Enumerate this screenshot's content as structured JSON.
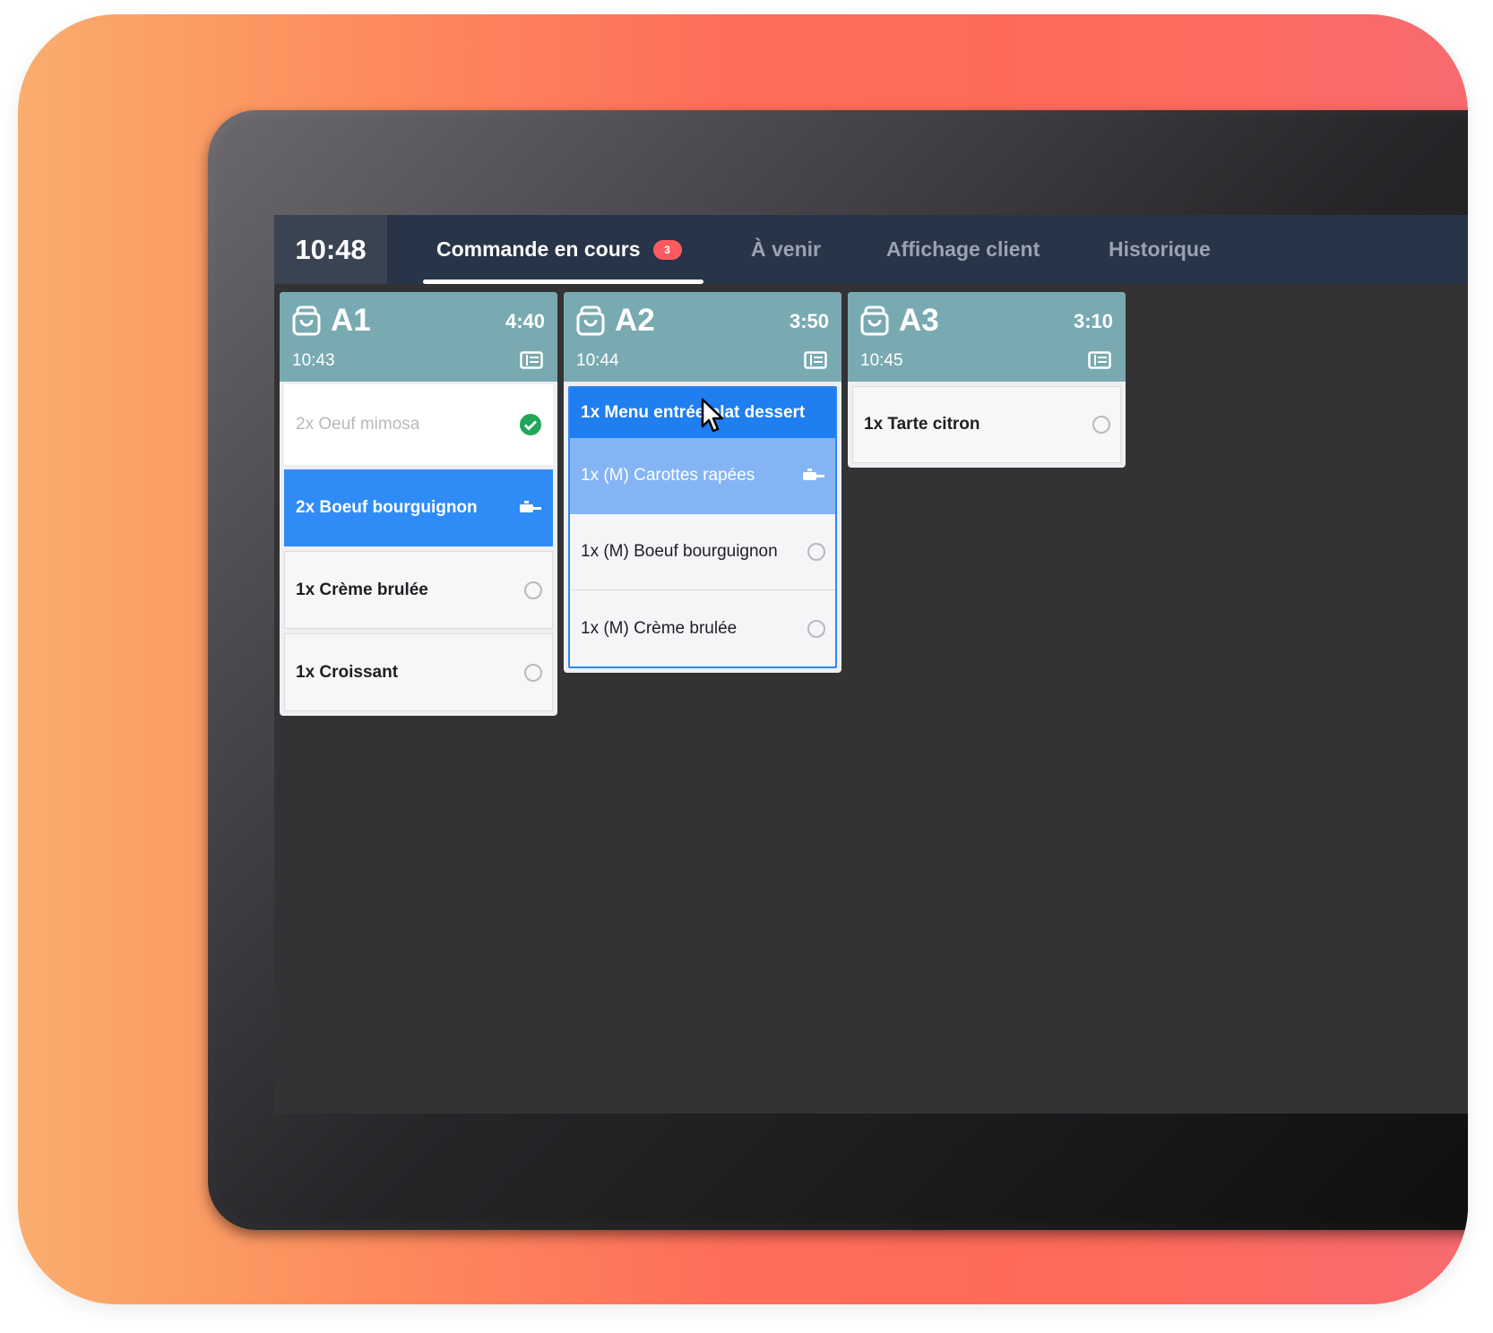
{
  "header": {
    "clock": "10:48",
    "tabs": [
      {
        "label": "Commande en cours",
        "badge": "3"
      },
      {
        "label": "À venir"
      },
      {
        "label": "Affichage client"
      },
      {
        "label": "Historique"
      }
    ]
  },
  "orders": [
    {
      "name": "A1",
      "timer": "4:40",
      "time": "10:43",
      "items": [
        {
          "label": "2x Oeuf mimosa",
          "status": "done"
        },
        {
          "label": "2x Boeuf bourguignon",
          "status": "in-progress"
        },
        {
          "label": "1x Crème brulée",
          "status": "pending"
        },
        {
          "label": "1x Croissant",
          "status": "pending"
        }
      ]
    },
    {
      "name": "A2",
      "timer": "3:50",
      "time": "10:44",
      "menu": {
        "label": "1x Menu entrée plat dessert",
        "items": [
          {
            "label": "1x (M) Carottes rapées",
            "status": "in-progress"
          },
          {
            "label": "1x (M) Boeuf bourguignon",
            "status": "pending"
          },
          {
            "label": "1x (M) Crème brulée",
            "status": "pending"
          }
        ]
      }
    },
    {
      "name": "A3",
      "timer": "3:10",
      "time": "10:45",
      "items": [
        {
          "label": "1x Tarte citron",
          "status": "pending"
        }
      ]
    }
  ],
  "colors": {
    "topbar": "#283448",
    "card_header": "#79aab1",
    "active_item": "#2f8cf6",
    "done_check": "#1fa85a",
    "badge": "#ff5a5f"
  }
}
